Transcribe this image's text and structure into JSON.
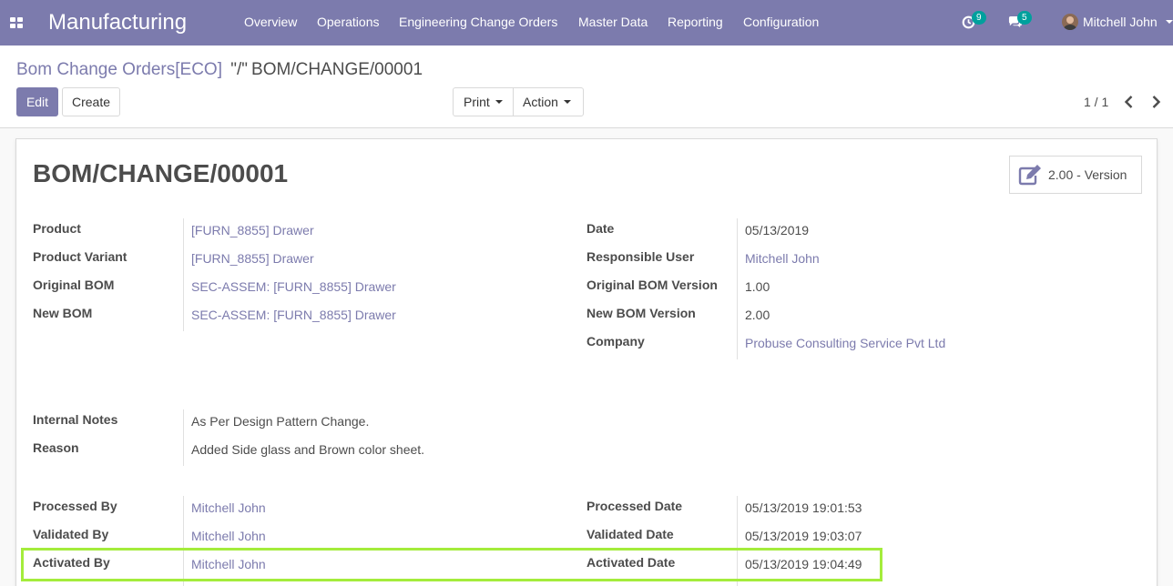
{
  "navbar": {
    "app_name": "Manufacturing",
    "menu": [
      "Overview",
      "Operations",
      "Engineering Change Orders",
      "Master Data",
      "Reporting",
      "Configuration"
    ],
    "activity_count": "9",
    "messages_count": "5",
    "user_name": "Mitchell John",
    "color": "#7c7bad"
  },
  "breadcrumb": {
    "parent": "Bom Change Orders[ECO]",
    "separator": "\"/\"",
    "current": "BOM/CHANGE/00001"
  },
  "toolbar": {
    "edit_label": "Edit",
    "create_label": "Create",
    "print_label": "Print",
    "action_label": "Action",
    "pager": "1 / 1"
  },
  "record": {
    "title": "BOM/CHANGE/00001",
    "version_button": "2.00 - Version",
    "left_fields": [
      {
        "label": "Product",
        "value": "[FURN_8855] Drawer"
      },
      {
        "label": "Product Variant",
        "value": "[FURN_8855] Drawer"
      },
      {
        "label": "Original BOM",
        "value": "SEC-ASSEM: [FURN_8855] Drawer"
      },
      {
        "label": "New BOM",
        "value": "SEC-ASSEM: [FURN_8855] Drawer"
      }
    ],
    "right_fields": [
      {
        "label": "Date",
        "value": "05/13/2019"
      },
      {
        "label": "Responsible User",
        "value": "Mitchell John"
      },
      {
        "label": "Original BOM Version",
        "value": "1.00"
      },
      {
        "label": "New BOM Version",
        "value": "2.00"
      },
      {
        "label": "Company",
        "value": "Probuse Consulting Service Pvt Ltd"
      }
    ],
    "notes_fields": [
      {
        "label": "Internal Notes",
        "value": "As Per Design Pattern Change."
      },
      {
        "label": "Reason",
        "value": "Added Side glass and Brown color sheet."
      }
    ],
    "process_left": [
      {
        "label": "Processed By",
        "value": "Mitchell John"
      },
      {
        "label": "Validated By",
        "value": "Mitchell John"
      },
      {
        "label": "Activated By",
        "value": "Mitchell John"
      }
    ],
    "process_right": [
      {
        "label": "Processed Date",
        "value": "05/13/2019 19:01:53"
      },
      {
        "label": "Validated Date",
        "value": "05/13/2019 19:03:07"
      },
      {
        "label": "Activated Date",
        "value": "05/13/2019 19:04:49"
      }
    ]
  },
  "highlight_color": "#a4ec3c",
  "icons": [
    "apps-grid-icon",
    "activity-clock-icon",
    "messages-icon",
    "chevron-left-icon",
    "chevron-right-icon",
    "edit-version-icon"
  ]
}
